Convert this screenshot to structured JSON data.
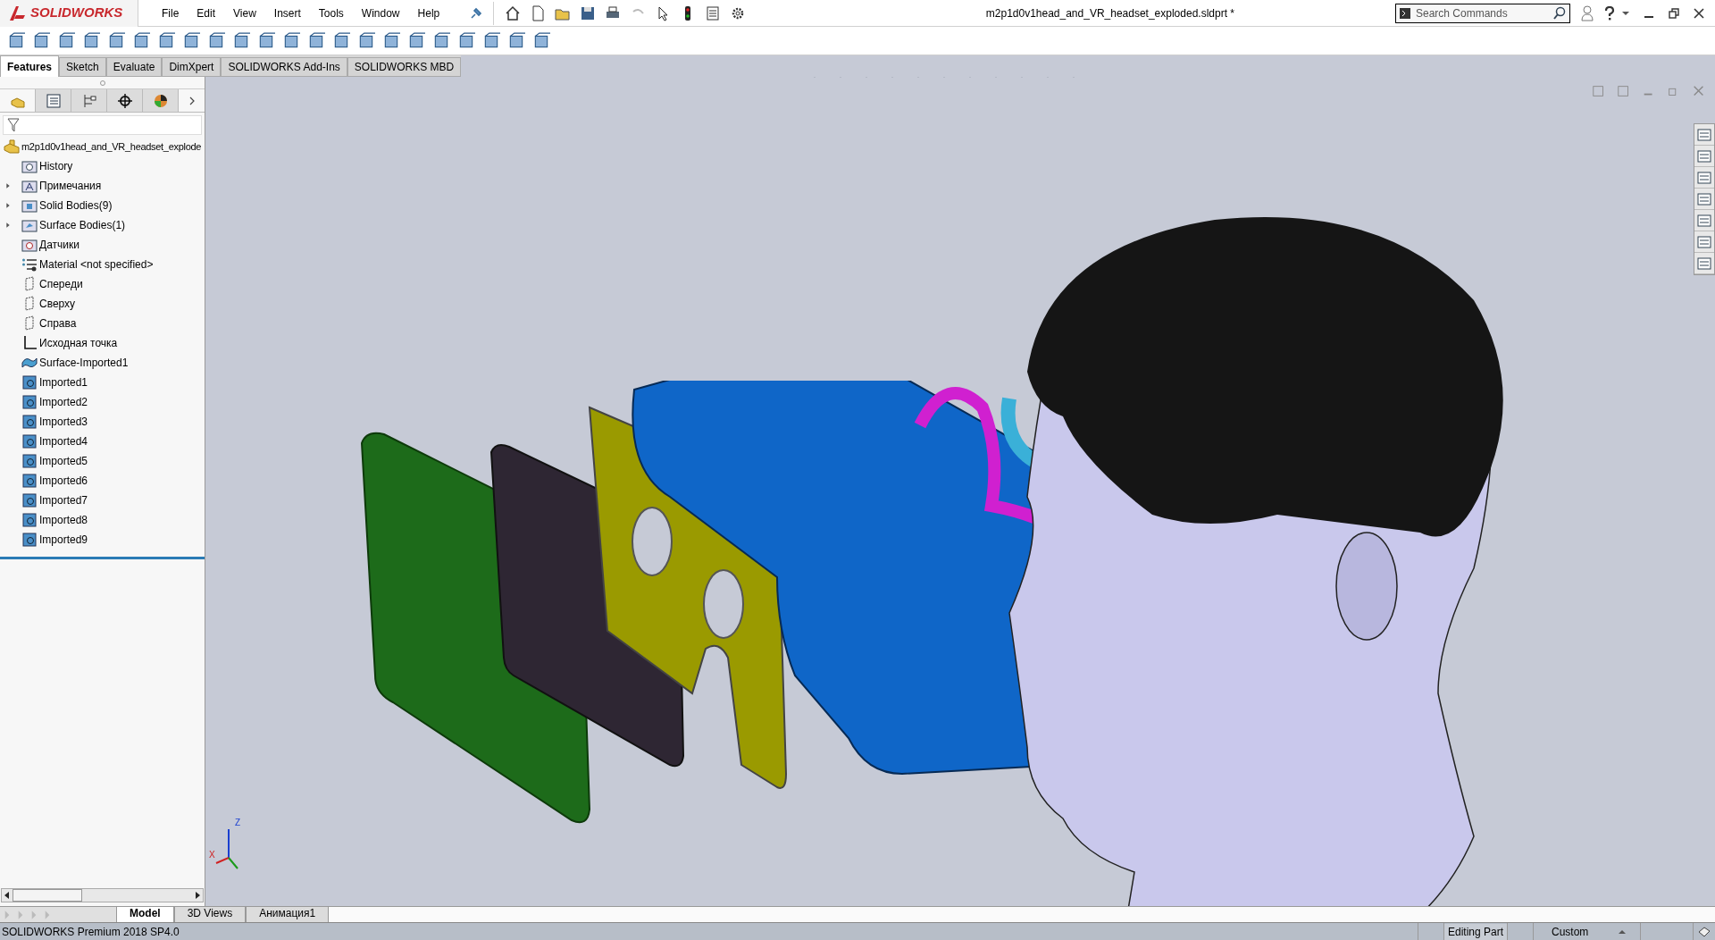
{
  "app": {
    "logo": "SOLIDWORKS"
  },
  "menu": [
    "File",
    "Edit",
    "View",
    "Insert",
    "Tools",
    "Window",
    "Help"
  ],
  "window": {
    "title": "m2p1d0v1head_and_VR_headset_exploded.sldprt *"
  },
  "search": {
    "placeholder": "Search Commands"
  },
  "command_tabs": [
    {
      "label": "Features",
      "selected": true
    },
    {
      "label": "Sketch",
      "selected": false
    },
    {
      "label": "Evaluate",
      "selected": false
    },
    {
      "label": "DimXpert",
      "selected": false
    },
    {
      "label": "SOLIDWORKS Add-Ins",
      "selected": false
    },
    {
      "label": "SOLIDWORKS MBD",
      "selected": false
    }
  ],
  "panel_tabs": [
    {
      "kind": "feature",
      "selected": true
    },
    {
      "kind": "property",
      "selected": false
    },
    {
      "kind": "config",
      "selected": false
    },
    {
      "kind": "dimxpert",
      "selected": false
    },
    {
      "kind": "display",
      "selected": false
    }
  ],
  "tree": {
    "root": "m2p1d0v1head_and_VR_headset_explode",
    "items": [
      {
        "label": "History",
        "kind": "history",
        "expandable": false
      },
      {
        "label": "Примечания",
        "kind": "annotations",
        "expandable": true
      },
      {
        "label": "Solid Bodies(9)",
        "kind": "solid-folder",
        "expandable": true
      },
      {
        "label": "Surface Bodies(1)",
        "kind": "surface-folder",
        "expandable": true
      },
      {
        "label": "Датчики",
        "kind": "sensors",
        "expandable": false
      },
      {
        "label": "Material <not specified>",
        "kind": "material",
        "expandable": false
      },
      {
        "label": "Спереди",
        "kind": "plane",
        "expandable": false
      },
      {
        "label": "Сверху",
        "kind": "plane",
        "expandable": false
      },
      {
        "label": "Справа",
        "kind": "plane",
        "expandable": false
      },
      {
        "label": "Исходная точка",
        "kind": "origin",
        "expandable": false
      },
      {
        "label": "Surface-Imported1",
        "kind": "surface",
        "expandable": false
      },
      {
        "label": "Imported1",
        "kind": "body",
        "expandable": false
      },
      {
        "label": "Imported2",
        "kind": "body",
        "expandable": false
      },
      {
        "label": "Imported3",
        "kind": "body",
        "expandable": false
      },
      {
        "label": "Imported4",
        "kind": "body",
        "expandable": false
      },
      {
        "label": "Imported5",
        "kind": "body",
        "expandable": false
      },
      {
        "label": "Imported6",
        "kind": "body",
        "expandable": false
      },
      {
        "label": "Imported7",
        "kind": "body",
        "expandable": false
      },
      {
        "label": "Imported8",
        "kind": "body",
        "expandable": false
      },
      {
        "label": "Imported9",
        "kind": "body",
        "expandable": false
      }
    ]
  },
  "triad": {
    "x": "X",
    "z": "Z"
  },
  "bottom_tabs": [
    {
      "label": "Model",
      "selected": true
    },
    {
      "label": "3D Views",
      "selected": false
    },
    {
      "label": "Анимация1",
      "selected": false
    }
  ],
  "status_bar": {
    "product": "SOLIDWORKS Premium 2018 SP4.0",
    "mode": "Editing Part",
    "units": "Custom"
  }
}
